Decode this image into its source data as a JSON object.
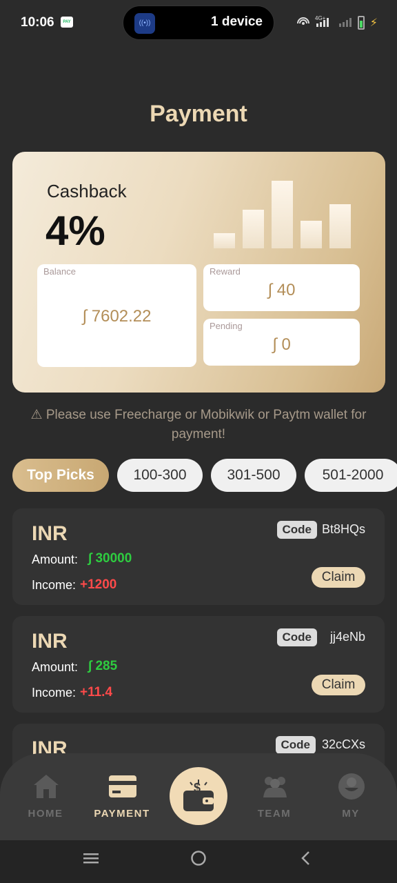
{
  "status_bar": {
    "time": "10:06",
    "island_text": "1 device",
    "network": "4G+"
  },
  "page": {
    "title": "Payment"
  },
  "cashback_card": {
    "label": "Cashback",
    "value": "4%",
    "balance": {
      "label": "Balance",
      "value": "∫ 7602.22"
    },
    "reward": {
      "label": "Reward",
      "value": "∫ 40"
    },
    "pending": {
      "label": "Pending",
      "value": "∫ 0"
    }
  },
  "notice": "⚠ Please use Freecharge or Mobikwik or Paytm wallet for payment!",
  "filters": [
    {
      "label": "Top Picks",
      "active": true
    },
    {
      "label": "100-300",
      "active": false
    },
    {
      "label": "301-500",
      "active": false
    },
    {
      "label": "501-2000",
      "active": false
    }
  ],
  "offers": [
    {
      "currency": "INR",
      "code_tag": "Code",
      "code": "Bt8HQs",
      "amount_label": "Amount:",
      "amount": "∫ 30000",
      "income_label": "Income:",
      "income": "+1200",
      "claim": "Claim"
    },
    {
      "currency": "INR",
      "code_tag": "Code",
      "code": "jj4eNb",
      "amount_label": "Amount:",
      "amount": "∫ 285",
      "income_label": "Income:",
      "income": "+11.4",
      "claim": "Claim"
    },
    {
      "currency": "INR",
      "code_tag": "Code",
      "code": "32cCXs"
    }
  ],
  "bottom_nav": {
    "home": "HOME",
    "payment": "PAYMENT",
    "team": "TEAM",
    "my": "MY"
  },
  "colors": {
    "accent": "#ecd8b4",
    "amount_green": "#2ecc40",
    "income_red": "#ff4a4a",
    "background": "#2b2b2b"
  }
}
